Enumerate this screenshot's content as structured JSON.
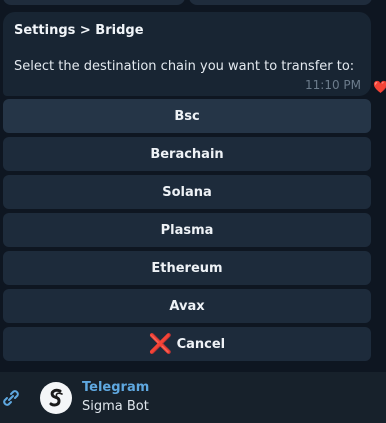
{
  "message": {
    "title": "Settings > Bridge",
    "text": "Select the destination chain you want to transfer to:",
    "time": "11:10 PM",
    "reaction": "❤️"
  },
  "keyboard": {
    "buttons": [
      {
        "label": "Bsc"
      },
      {
        "label": "Berachain"
      },
      {
        "label": "Solana"
      },
      {
        "label": "Plasma"
      },
      {
        "label": "Ethereum"
      },
      {
        "label": "Avax"
      },
      {
        "label": "Cancel",
        "icon": "❌"
      }
    ]
  },
  "link_preview": {
    "site": "Telegram",
    "title": "Sigma Bot",
    "icon": "link-icon"
  },
  "colors": {
    "background": "#0e1621",
    "bubble": "#182533",
    "button": "#1d2b3b",
    "link": "#5fa8e0",
    "cancel": "#e53935"
  }
}
